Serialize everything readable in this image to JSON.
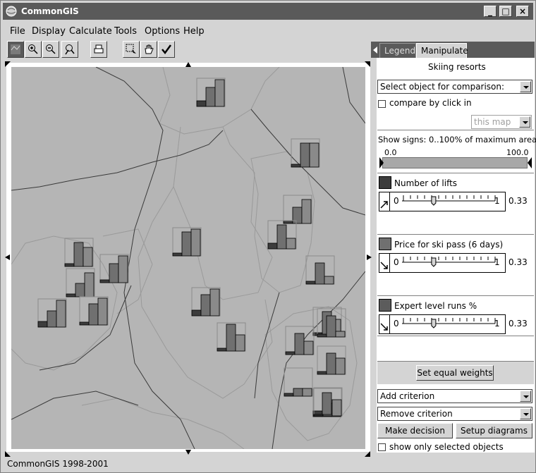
{
  "window": {
    "title": "CommonGIS",
    "controls": [
      "_",
      "□",
      "×"
    ]
  },
  "menu": {
    "items": [
      "File",
      "Display",
      "Calculate",
      "Tools",
      "Options",
      "Help"
    ]
  },
  "toolbar": {
    "icons": [
      "map-icon",
      "zoom-in-icon",
      "zoom-out-icon",
      "zoom-fit-icon",
      "print-icon",
      "select-rect-icon",
      "pan-hand-icon",
      "confirm-check-icon"
    ]
  },
  "status": {
    "text": "CommonGIS 1998-2001"
  },
  "tabs": {
    "legend": "Legend",
    "manipulate": "Manipulate"
  },
  "panel": {
    "title": "Skiing resorts",
    "compare_select": "Select object for comparison:",
    "compare_by_click": "compare by click in",
    "compare_target": "this map",
    "show_signs": "Show signs: 0..100% of maximum area",
    "range_min": "0.0",
    "range_max": "100.0",
    "criteria": [
      {
        "name": "Number of lifts",
        "min": "0",
        "max": "1",
        "weight": "0.33",
        "color": "#3c3c3c"
      },
      {
        "name": "Price for ski pass (6 days)",
        "min": "0",
        "max": "1",
        "weight": "0.33",
        "color": "#707070"
      },
      {
        "name": "Expert level runs %",
        "min": "0",
        "max": "1",
        "weight": "0.33",
        "color": "#5c5c5c"
      }
    ],
    "set_equal_weights": "Set equal weights",
    "add_criterion": "Add criterion",
    "remove_criterion": "Remove criterion",
    "make_decision": "Make decision",
    "setup_diagrams": "Setup diagrams",
    "show_only_selected": "show only selected objects"
  },
  "map": {
    "colors": {
      "background": "#b5b5b5",
      "bar_dark": "#3c3c3c",
      "bar_mid": "#707070",
      "bar_light": "#8a8a8a"
    },
    "diagrams": [
      {
        "v": [
          0.2,
          0.7,
          1.0
        ]
      },
      {
        "v": [
          0.1,
          0.9,
          0.9
        ]
      },
      {
        "v": [
          0.1,
          0.6,
          0.9
        ]
      },
      {
        "v": [
          0.2,
          0.9,
          0.4
        ]
      },
      {
        "v": [
          0.1,
          0.8,
          0.3
        ]
      },
      {
        "v": [
          0.1,
          0.7,
          1.0
        ]
      },
      {
        "v": [
          0.1,
          0.9,
          1.0
        ]
      },
      {
        "v": [
          0.2,
          0.8,
          1.0
        ]
      },
      {
        "v": [
          0.1,
          1.0,
          0.6
        ]
      },
      {
        "v": [
          0.1,
          0.9,
          0.7
        ]
      },
      {
        "v": [
          0.1,
          0.5,
          0.9
        ]
      },
      {
        "v": [
          0.2,
          0.6,
          1.0
        ]
      },
      {
        "v": [
          0.1,
          0.8,
          1.0
        ]
      },
      {
        "v": [
          0.1,
          0.9,
          0.6
        ]
      },
      {
        "v": [
          0.1,
          0.8,
          0.5
        ]
      },
      {
        "v": [
          0.1,
          0.8,
          0.6
        ]
      },
      {
        "v": [
          0.1,
          0.3,
          0.3
        ]
      },
      {
        "v": [
          0.2,
          0.9,
          0.5
        ]
      },
      {
        "v": [
          0.1,
          0.8,
          0.2
        ]
      },
      {
        "v": [
          0.0,
          0.0,
          0.6
        ]
      }
    ]
  }
}
